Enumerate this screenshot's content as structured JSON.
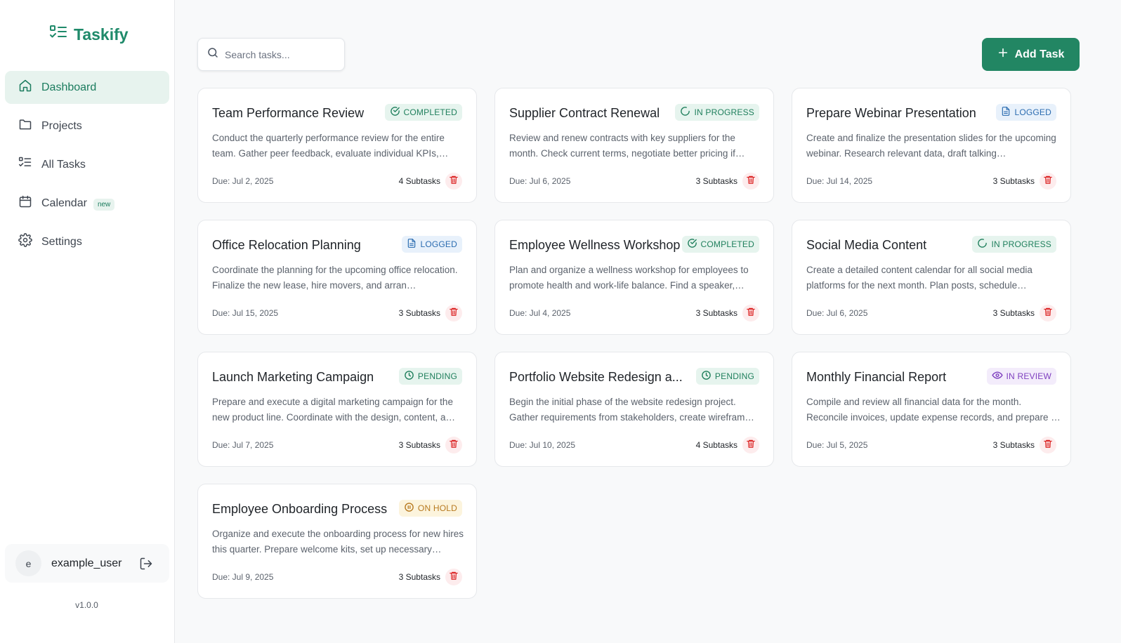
{
  "app": {
    "name": "Taskify",
    "version": "v1.0.0"
  },
  "colors": {
    "brand": "#1f8a6a",
    "accent_button": "#228663",
    "delete": "#dc2626"
  },
  "nav": [
    {
      "label": "Dashboard",
      "icon": "home-icon",
      "active": true
    },
    {
      "label": "Projects",
      "icon": "folder-icon"
    },
    {
      "label": "All Tasks",
      "icon": "task-list-icon"
    },
    {
      "label": "Calendar",
      "icon": "calendar-icon",
      "badge": "new"
    },
    {
      "label": "Settings",
      "icon": "gear-icon"
    }
  ],
  "user": {
    "initial": "e",
    "name": "example_user"
  },
  "search": {
    "placeholder": "Search tasks..."
  },
  "add_button": {
    "label": "Add Task"
  },
  "statuses": {
    "completed": {
      "label": "COMPLETED",
      "icon": "check-circle-icon",
      "bg": "#e6f4ee",
      "fg": "#1f7f5c"
    },
    "in_progress": {
      "label": "IN PROGRESS",
      "icon": "spinner-icon",
      "bg": "#e6f4ee",
      "fg": "#1f7f5c"
    },
    "logged": {
      "label": "LOGGED",
      "icon": "document-icon",
      "bg": "#e8f1fb",
      "fg": "#2b6cb0"
    },
    "pending": {
      "label": "PENDING",
      "icon": "clock-icon",
      "bg": "#e6f4ee",
      "fg": "#1f7f5c"
    },
    "in_review": {
      "label": "IN REVIEW",
      "icon": "eye-icon",
      "bg": "#f3ecfb",
      "fg": "#7e3fbf"
    },
    "on_hold": {
      "label": "ON HOLD",
      "icon": "pause-circle-icon",
      "bg": "#fcf4dd",
      "fg": "#b7791f"
    }
  },
  "tasks": [
    {
      "title": "Team Performance Review",
      "status": "completed",
      "description": "Conduct the quarterly performance review for the entire team. Gather peer feedback, evaluate individual KPIs, and…",
      "due": "Due: Jul 2, 2025",
      "subtasks": "4 Subtasks"
    },
    {
      "title": "Supplier Contract Renewal",
      "status": "in_progress",
      "description": "Review and renew contracts with key suppliers for the month. Check current terms, negotiate better pricing if…",
      "due": "Due: Jul 6, 2025",
      "subtasks": "3 Subtasks"
    },
    {
      "title": "Prepare Webinar Presentation",
      "status": "logged",
      "description": "Create and finalize the presentation slides for the upcoming webinar. Research relevant data, draft talking…",
      "due": "Due: Jul 14, 2025",
      "subtasks": "3 Subtasks"
    },
    {
      "title": "Office Relocation Planning",
      "status": "logged",
      "description": "Coordinate the planning for the upcoming office relocation. Finalize the new lease, hire movers, and arran…",
      "due": "Due: Jul 15, 2025",
      "subtasks": "3 Subtasks"
    },
    {
      "title": "Employee Wellness Workshop",
      "status": "completed",
      "description": "Plan and organize a wellness workshop for employees to promote health and work-life balance. Find a speaker,…",
      "due": "Due: Jul 4, 2025",
      "subtasks": "3 Subtasks"
    },
    {
      "title": "Social Media Content",
      "status": "in_progress",
      "description": "Create a detailed content calendar for all social media platforms for the next month. Plan posts, schedule…",
      "due": "Due: Jul 6, 2025",
      "subtasks": "3 Subtasks"
    },
    {
      "title": "Launch Marketing Campaign",
      "status": "pending",
      "description": "Prepare and execute a digital marketing campaign for the new product line. Coordinate with the design, content, a…",
      "due": "Due: Jul 7, 2025",
      "subtasks": "3 Subtasks"
    },
    {
      "title": "Portfolio Website Redesign a...",
      "status": "pending",
      "description": "Begin the initial phase of the website redesign project. Gather requirements from stakeholders, create wirefram…",
      "due": "Due: Jul 10, 2025",
      "subtasks": "4 Subtasks"
    },
    {
      "title": "Monthly Financial Report",
      "status": "in_review",
      "description": "Compile and review all financial data for the month. Reconcile invoices, update expense records, and prepare …",
      "due": "Due: Jul 5, 2025",
      "subtasks": "3 Subtasks"
    },
    {
      "title": "Employee Onboarding Process",
      "status": "on_hold",
      "description": "Organize and execute the onboarding process for new hires this quarter. Prepare welcome kits, set up necessary…",
      "due": "Due: Jul 9, 2025",
      "subtasks": "3 Subtasks"
    }
  ]
}
